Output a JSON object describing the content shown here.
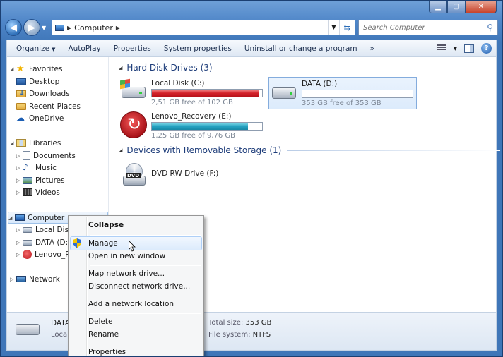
{
  "address": {
    "crumb": "Computer"
  },
  "search": {
    "placeholder": "Search Computer"
  },
  "toolbar": {
    "items": [
      "Organize",
      "AutoPlay",
      "Properties",
      "System properties",
      "Uninstall or change a program",
      "»"
    ]
  },
  "nav": {
    "favorites": {
      "label": "Favorites",
      "items": [
        "Desktop",
        "Downloads",
        "Recent Places",
        "OneDrive"
      ]
    },
    "libraries": {
      "label": "Libraries",
      "items": [
        "Documents",
        "Music",
        "Pictures",
        "Videos"
      ]
    },
    "computer": {
      "label": "Computer",
      "items": [
        "Local Disk",
        "DATA (D:)",
        "Lenovo_Re"
      ]
    },
    "network": {
      "label": "Network"
    }
  },
  "content": {
    "hdd_group": "Hard Disk Drives (3)",
    "removable_group": "Devices with Removable Storage (1)",
    "drives": [
      {
        "name": "Local Disk (C:)",
        "free": "2,51 GB free of 102 GB",
        "used_fraction": 0.975
      },
      {
        "name": "DATA (D:)",
        "free": "353 GB free of 353 GB",
        "used_fraction": 0.0
      },
      {
        "name": "Lenovo_Recovery (E:)",
        "free": "1,25 GB free of 9,76 GB",
        "used_fraction": 0.872
      }
    ],
    "dvd": {
      "name": "DVD RW Drive (F:)",
      "icon_label": "DVD"
    }
  },
  "details": {
    "name": "DATA",
    "type": "Local",
    "total_label": "Total size:",
    "total_value": "353 GB",
    "fs_label": "File system:",
    "fs_value": "NTFS"
  },
  "context_menu": {
    "collapse": "Collapse",
    "manage": "Manage",
    "open_new": "Open in new window",
    "map": "Map network drive...",
    "disconnect": "Disconnect network drive...",
    "add_location": "Add a network location",
    "delete": "Delete",
    "rename": "Rename",
    "properties": "Properties"
  },
  "colors": {
    "used_bar": "#d3222a",
    "recovery_bar": "#26a3c2",
    "accent": "#1e3d7a"
  }
}
